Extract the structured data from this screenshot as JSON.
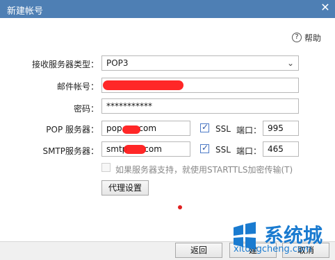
{
  "window": {
    "title": "新建帐号"
  },
  "help": {
    "label": "帮助"
  },
  "form": {
    "server_type_label": "接收服务器类型：",
    "server_type_value": "POP3",
    "account_label": "邮件帐号：",
    "password_label": "密码：",
    "password_value": "***********",
    "pop_label": "POP 服务器：",
    "pop_value": "pop.",
    "pop_value_tail": "com",
    "smtp_label": "SMTP服务器：",
    "smtp_value": "smtp",
    "smtp_value_tail": "com",
    "ssl_label": "SSL",
    "port_label": "端口：",
    "pop_port": "995",
    "smtp_port": "465",
    "starttls_label": "如果服务器支持，就使用STARTTLS加密传输(T)",
    "proxy_button": "代理设置"
  },
  "footer": {
    "back_button": "返回",
    "next_button": "建",
    "cancel_button": "取消"
  },
  "watermark": {
    "brand": "系统城",
    "site": "xitongcheng.com"
  },
  "colors": {
    "titlebar": "#4e7fb4",
    "redaction": "#ff1b1b",
    "accent": "#1a7bd0"
  }
}
